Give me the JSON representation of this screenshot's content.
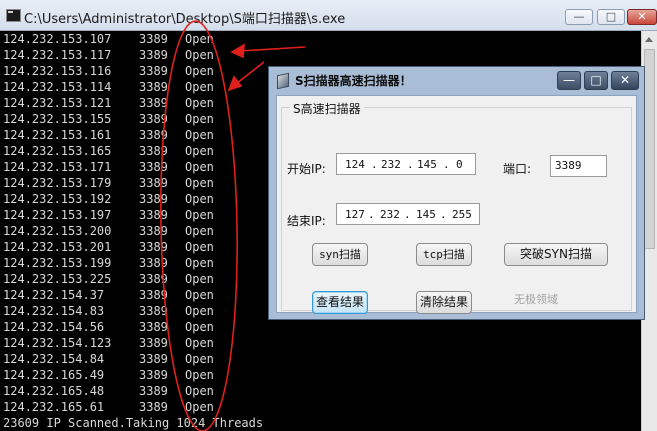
{
  "console": {
    "title": "C:\\Users\\Administrator\\Desktop\\S端口扫描器\\s.exe",
    "lines": [
      {
        "ip": "124.232.153.107",
        "port": "3389",
        "status": "Open"
      },
      {
        "ip": "124.232.153.117",
        "port": "3389",
        "status": "Open"
      },
      {
        "ip": "124.232.153.116",
        "port": "3389",
        "status": "Open"
      },
      {
        "ip": "124.232.153.114",
        "port": "3389",
        "status": "Open"
      },
      {
        "ip": "124.232.153.121",
        "port": "3389",
        "status": "Open"
      },
      {
        "ip": "124.232.153.155",
        "port": "3389",
        "status": "Open"
      },
      {
        "ip": "124.232.153.161",
        "port": "3389",
        "status": "Open"
      },
      {
        "ip": "124.232.153.165",
        "port": "3389",
        "status": "Open"
      },
      {
        "ip": "124.232.153.171",
        "port": "3389",
        "status": "Open"
      },
      {
        "ip": "124.232.153.179",
        "port": "3389",
        "status": "Open"
      },
      {
        "ip": "124.232.153.192",
        "port": "3389",
        "status": "Open"
      },
      {
        "ip": "124.232.153.197",
        "port": "3389",
        "status": "Open"
      },
      {
        "ip": "124.232.153.200",
        "port": "3389",
        "status": "Open"
      },
      {
        "ip": "124.232.153.201",
        "port": "3389",
        "status": "Open"
      },
      {
        "ip": "124.232.153.199",
        "port": "3389",
        "status": "Open"
      },
      {
        "ip": "124.232.153.225",
        "port": "3389",
        "status": "Open"
      },
      {
        "ip": "124.232.154.37",
        "port": "3389",
        "status": "Open"
      },
      {
        "ip": "124.232.154.83",
        "port": "3389",
        "status": "Open"
      },
      {
        "ip": "124.232.154.56",
        "port": "3389",
        "status": "Open"
      },
      {
        "ip": "124.232.154.123",
        "port": "3389",
        "status": "Open"
      },
      {
        "ip": "124.232.154.84",
        "port": "3389",
        "status": "Open"
      },
      {
        "ip": "124.232.165.49",
        "port": "3389",
        "status": "Open"
      },
      {
        "ip": "124.232.165.48",
        "port": "3389",
        "status": "Open"
      },
      {
        "ip": "124.232.165.61",
        "port": "3389",
        "status": "Open"
      }
    ],
    "summary": "23609 IP Scanned.Taking 1024 Threads",
    "window_controls": {
      "minimize": "—",
      "maximize": "□",
      "close": "✕"
    }
  },
  "dialog": {
    "title": "S扫描器高速扫描器！",
    "group_label": "S高速扫描器",
    "start_ip_label": "开始IP:",
    "start_ip": [
      "124",
      "232",
      "145",
      "0"
    ],
    "end_ip_label": "结束IP:",
    "end_ip": [
      "127",
      "232",
      "145",
      "255"
    ],
    "port_label": "端口:",
    "port_value": "3389",
    "buttons": {
      "syn_scan": "syn扫描",
      "tcp_scan": "tcp扫描",
      "bypass_syn_scan": "突破SYN扫描",
      "view_results": "查看结果",
      "clear_results": "清除结果"
    },
    "footer": "无极领域",
    "window_controls": {
      "minimize": "—",
      "maximize": "□",
      "close": "✕"
    }
  },
  "colors": {
    "console_bg": "#000000",
    "console_text": "#d8d8d8",
    "annotation": "#e0201a",
    "dialog_frame": "#a9bdd6"
  },
  "icons": [
    "console-app-icon",
    "scanner-app-icon"
  ]
}
